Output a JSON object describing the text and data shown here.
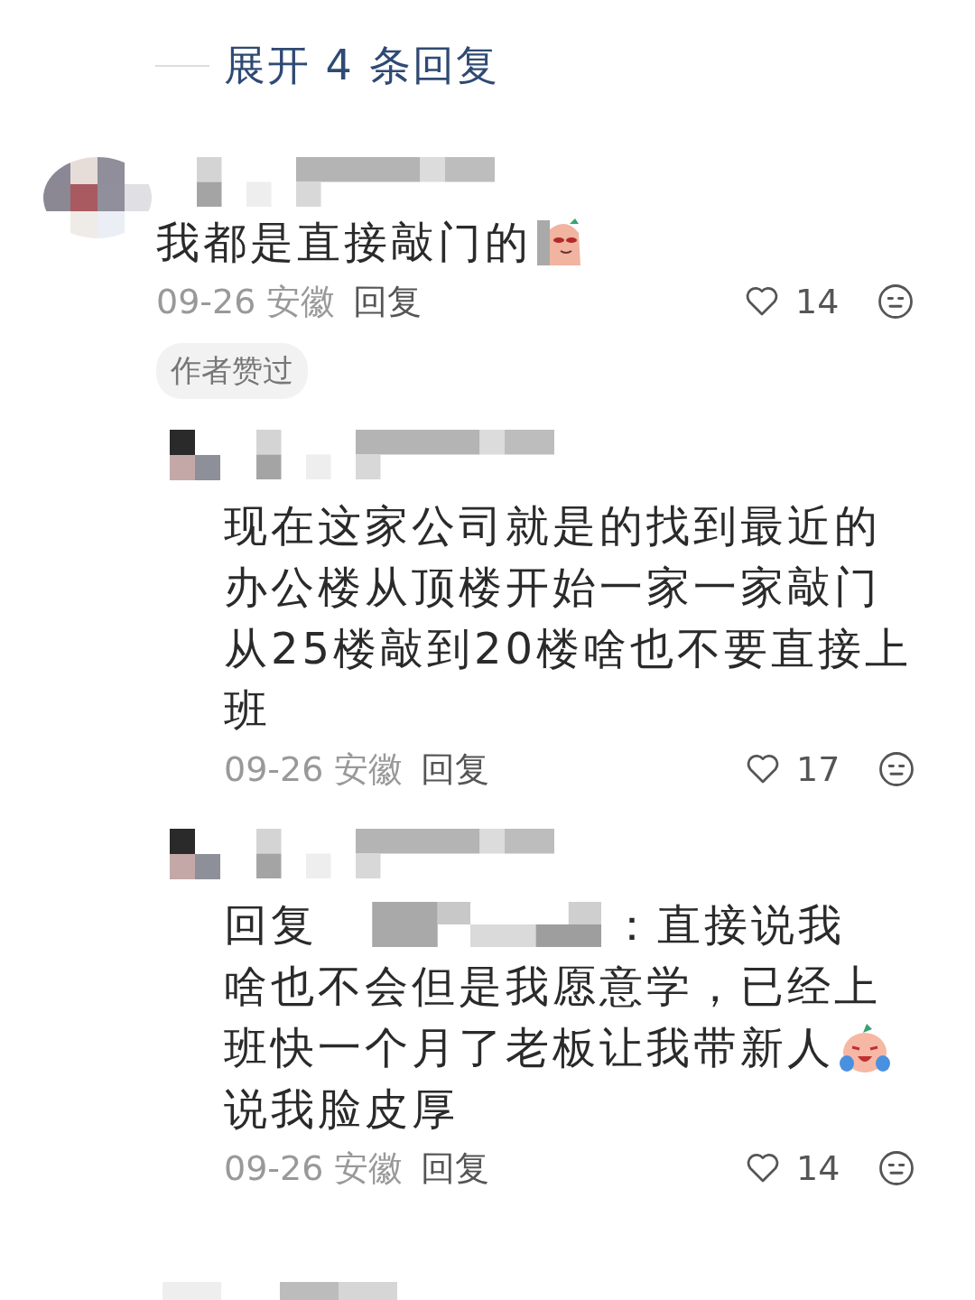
{
  "expand_replies": {
    "label": "展开 4 条回复"
  },
  "comments": [
    {
      "kind": "top",
      "lines": [
        {
          "text": "我都是直接敲门的",
          "sticker": {
            "kind": "peek"
          }
        }
      ],
      "date": "09-26",
      "location": "安徽",
      "reply_label": "回复",
      "likes": "14",
      "badge": "作者赞过"
    },
    {
      "kind": "reply",
      "lines": [
        {
          "text": "现在这家公司就是的找到最近的"
        },
        {
          "text": "办公楼从顶楼开始一家一家敲门"
        },
        {
          "text": "从25楼敲到20楼啥也不要直接上"
        },
        {
          "text": "班"
        }
      ],
      "date": "09-26",
      "location": "安徽",
      "reply_label": "回复",
      "likes": "17"
    },
    {
      "kind": "reply",
      "lines": [
        {
          "prefix": "回复",
          "text": "：直接说我"
        },
        {
          "text": "啥也不会但是我愿意学，已经上"
        },
        {
          "text": "班快一个月了老板让我带新人",
          "sticker": {
            "kind": "cry"
          }
        },
        {
          "text": "说我脸皮厚"
        }
      ],
      "date": "09-26",
      "location": "安徽",
      "reply_label": "回复",
      "likes": "14"
    }
  ]
}
